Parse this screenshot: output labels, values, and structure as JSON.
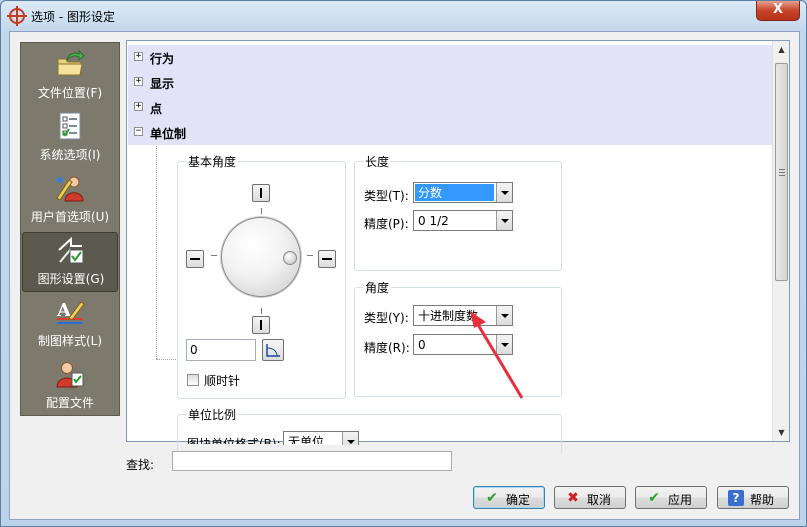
{
  "window": {
    "title": "选项 - 图形设定",
    "close_symbol": "X"
  },
  "nav": {
    "items": [
      {
        "label": "文件位置(F)",
        "icon": "folder-arrow-icon"
      },
      {
        "label": "系统选项(I)",
        "icon": "checklist-icon"
      },
      {
        "label": "用户首选项(U)",
        "icon": "user-pencil-icon"
      },
      {
        "label": "图形设置(G)",
        "icon": "graphics-settings-icon",
        "active": true
      },
      {
        "label": "制图样式(L)",
        "icon": "text-style-icon"
      },
      {
        "label": "配置文件",
        "icon": "user-profile-icon"
      }
    ]
  },
  "tree": {
    "nodes": [
      {
        "label": "行为",
        "toggle": "+"
      },
      {
        "label": "显示",
        "toggle": "+"
      },
      {
        "label": "点",
        "toggle": "+"
      },
      {
        "label": "单位制",
        "toggle": "−"
      }
    ]
  },
  "base_angle": {
    "title": "基本角度",
    "value": "0",
    "clockwise_label": "顺时针",
    "clockwise_checked": false
  },
  "length": {
    "title": "长度",
    "type_label": "类型(T):",
    "type_value": "分数",
    "precision_label": "精度(P):",
    "precision_value": "0 1/2"
  },
  "angle": {
    "title": "角度",
    "type_label": "类型(Y):",
    "type_value": "十进制度数",
    "precision_label": "精度(R):",
    "precision_value": "0"
  },
  "unit_scale": {
    "title": "单位比例",
    "format_label": "图块单位格式(B):",
    "format_value": "无单位"
  },
  "search": {
    "label": "查找:",
    "value": ""
  },
  "buttons": {
    "ok": "确定",
    "cancel": "取消",
    "apply": "应用",
    "help": "帮助"
  },
  "colors": {
    "tree_row_bg": "#e3e3f8",
    "nav_bg": "#7d7a6d",
    "selected_bg": "#3399ff",
    "annotation_arrow": "#e8303c"
  }
}
